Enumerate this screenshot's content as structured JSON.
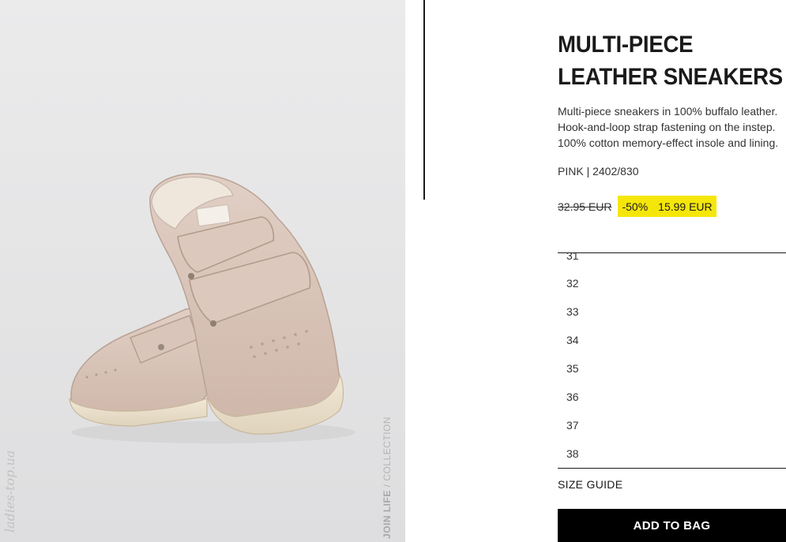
{
  "product": {
    "title_line1": "MULTI-PIECE",
    "title_line2": "LEATHER SNEAKERS",
    "description": [
      "Multi-piece sneakers in 100% buffalo leather.",
      "Hook-and-loop strap fastening on the instep.",
      "100% cotton memory-effect insole and lining."
    ],
    "color_ref": "PINK | 2402/830",
    "old_price": "32.95 EUR",
    "discount": "-50%",
    "sale_price": "15.99 EUR",
    "badge_color": "#f5e60a"
  },
  "image": {
    "collection_bold": "JOIN LIFE",
    "collection_rest": " / COLLECTION",
    "watermark": "ladies-top.ua"
  },
  "sizes": [
    "31",
    "32",
    "33",
    "34",
    "35",
    "36",
    "37",
    "38"
  ],
  "size_guide_label": "SIZE GUIDE",
  "add_to_bag_label": "ADD TO BAG"
}
